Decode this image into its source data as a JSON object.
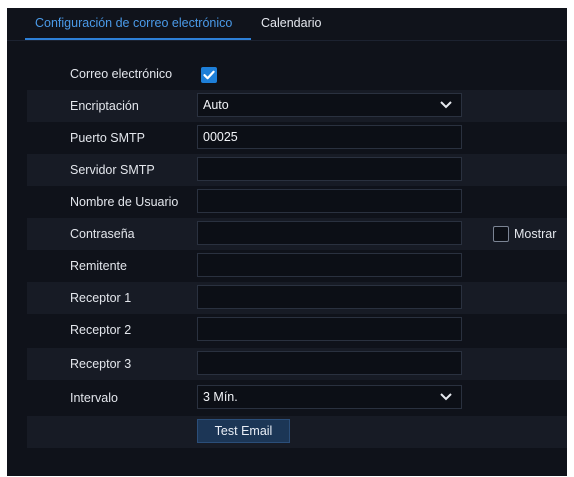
{
  "tabs": [
    {
      "label": "Configuración de correo electrónico",
      "active": true
    },
    {
      "label": "Calendario",
      "active": false
    }
  ],
  "form": {
    "email": {
      "label": "Correo electrónico",
      "checked": true
    },
    "encryption": {
      "label": "Encriptación",
      "value": "Auto"
    },
    "smtp_port": {
      "label": "Puerto SMTP",
      "value": "00025"
    },
    "smtp_server": {
      "label": "Servidor SMTP",
      "value": ""
    },
    "username": {
      "label": "Nombre de Usuario",
      "value": ""
    },
    "password": {
      "label": "Contraseña",
      "value": "",
      "show_label": "Mostrar",
      "show_checked": false
    },
    "sender": {
      "label": "Remitente",
      "value": ""
    },
    "receiver1": {
      "label": "Receptor 1",
      "value": ""
    },
    "receiver2": {
      "label": "Receptor 2",
      "value": ""
    },
    "receiver3": {
      "label": "Receptor 3",
      "value": ""
    },
    "interval": {
      "label": "Intervalo",
      "value": "3 Mín."
    },
    "test_button": "Test Email"
  },
  "colors": {
    "accent": "#2d7fd6",
    "background": "#0f121a",
    "stripe": "#171b25"
  }
}
